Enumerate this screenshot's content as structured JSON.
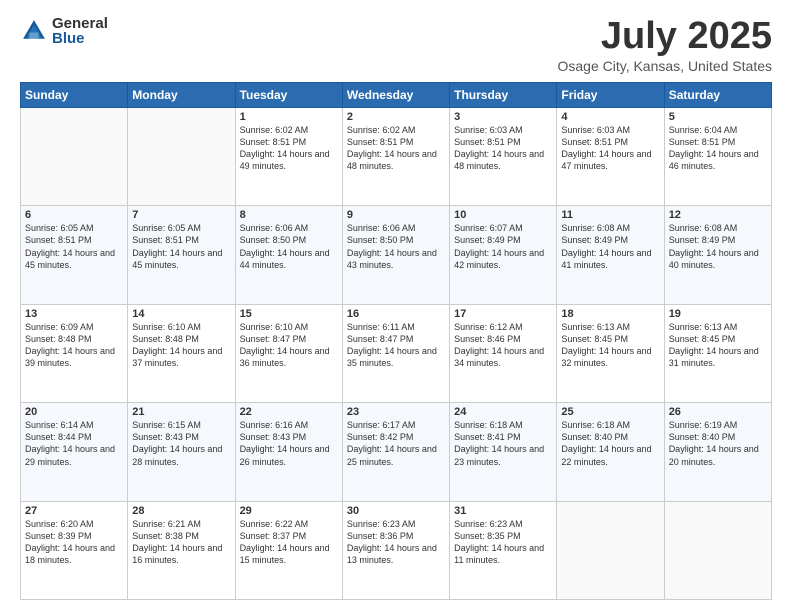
{
  "logo": {
    "general": "General",
    "blue": "Blue"
  },
  "title": "July 2025",
  "subtitle": "Osage City, Kansas, United States",
  "days": [
    "Sunday",
    "Monday",
    "Tuesday",
    "Wednesday",
    "Thursday",
    "Friday",
    "Saturday"
  ],
  "weeks": [
    [
      {
        "day": "",
        "sunrise": "",
        "sunset": "",
        "daylight": ""
      },
      {
        "day": "",
        "sunrise": "",
        "sunset": "",
        "daylight": ""
      },
      {
        "day": "1",
        "sunrise": "Sunrise: 6:02 AM",
        "sunset": "Sunset: 8:51 PM",
        "daylight": "Daylight: 14 hours and 49 minutes."
      },
      {
        "day": "2",
        "sunrise": "Sunrise: 6:02 AM",
        "sunset": "Sunset: 8:51 PM",
        "daylight": "Daylight: 14 hours and 48 minutes."
      },
      {
        "day": "3",
        "sunrise": "Sunrise: 6:03 AM",
        "sunset": "Sunset: 8:51 PM",
        "daylight": "Daylight: 14 hours and 48 minutes."
      },
      {
        "day": "4",
        "sunrise": "Sunrise: 6:03 AM",
        "sunset": "Sunset: 8:51 PM",
        "daylight": "Daylight: 14 hours and 47 minutes."
      },
      {
        "day": "5",
        "sunrise": "Sunrise: 6:04 AM",
        "sunset": "Sunset: 8:51 PM",
        "daylight": "Daylight: 14 hours and 46 minutes."
      }
    ],
    [
      {
        "day": "6",
        "sunrise": "Sunrise: 6:05 AM",
        "sunset": "Sunset: 8:51 PM",
        "daylight": "Daylight: 14 hours and 45 minutes."
      },
      {
        "day": "7",
        "sunrise": "Sunrise: 6:05 AM",
        "sunset": "Sunset: 8:51 PM",
        "daylight": "Daylight: 14 hours and 45 minutes."
      },
      {
        "day": "8",
        "sunrise": "Sunrise: 6:06 AM",
        "sunset": "Sunset: 8:50 PM",
        "daylight": "Daylight: 14 hours and 44 minutes."
      },
      {
        "day": "9",
        "sunrise": "Sunrise: 6:06 AM",
        "sunset": "Sunset: 8:50 PM",
        "daylight": "Daylight: 14 hours and 43 minutes."
      },
      {
        "day": "10",
        "sunrise": "Sunrise: 6:07 AM",
        "sunset": "Sunset: 8:49 PM",
        "daylight": "Daylight: 14 hours and 42 minutes."
      },
      {
        "day": "11",
        "sunrise": "Sunrise: 6:08 AM",
        "sunset": "Sunset: 8:49 PM",
        "daylight": "Daylight: 14 hours and 41 minutes."
      },
      {
        "day": "12",
        "sunrise": "Sunrise: 6:08 AM",
        "sunset": "Sunset: 8:49 PM",
        "daylight": "Daylight: 14 hours and 40 minutes."
      }
    ],
    [
      {
        "day": "13",
        "sunrise": "Sunrise: 6:09 AM",
        "sunset": "Sunset: 8:48 PM",
        "daylight": "Daylight: 14 hours and 39 minutes."
      },
      {
        "day": "14",
        "sunrise": "Sunrise: 6:10 AM",
        "sunset": "Sunset: 8:48 PM",
        "daylight": "Daylight: 14 hours and 37 minutes."
      },
      {
        "day": "15",
        "sunrise": "Sunrise: 6:10 AM",
        "sunset": "Sunset: 8:47 PM",
        "daylight": "Daylight: 14 hours and 36 minutes."
      },
      {
        "day": "16",
        "sunrise": "Sunrise: 6:11 AM",
        "sunset": "Sunset: 8:47 PM",
        "daylight": "Daylight: 14 hours and 35 minutes."
      },
      {
        "day": "17",
        "sunrise": "Sunrise: 6:12 AM",
        "sunset": "Sunset: 8:46 PM",
        "daylight": "Daylight: 14 hours and 34 minutes."
      },
      {
        "day": "18",
        "sunrise": "Sunrise: 6:13 AM",
        "sunset": "Sunset: 8:45 PM",
        "daylight": "Daylight: 14 hours and 32 minutes."
      },
      {
        "day": "19",
        "sunrise": "Sunrise: 6:13 AM",
        "sunset": "Sunset: 8:45 PM",
        "daylight": "Daylight: 14 hours and 31 minutes."
      }
    ],
    [
      {
        "day": "20",
        "sunrise": "Sunrise: 6:14 AM",
        "sunset": "Sunset: 8:44 PM",
        "daylight": "Daylight: 14 hours and 29 minutes."
      },
      {
        "day": "21",
        "sunrise": "Sunrise: 6:15 AM",
        "sunset": "Sunset: 8:43 PM",
        "daylight": "Daylight: 14 hours and 28 minutes."
      },
      {
        "day": "22",
        "sunrise": "Sunrise: 6:16 AM",
        "sunset": "Sunset: 8:43 PM",
        "daylight": "Daylight: 14 hours and 26 minutes."
      },
      {
        "day": "23",
        "sunrise": "Sunrise: 6:17 AM",
        "sunset": "Sunset: 8:42 PM",
        "daylight": "Daylight: 14 hours and 25 minutes."
      },
      {
        "day": "24",
        "sunrise": "Sunrise: 6:18 AM",
        "sunset": "Sunset: 8:41 PM",
        "daylight": "Daylight: 14 hours and 23 minutes."
      },
      {
        "day": "25",
        "sunrise": "Sunrise: 6:18 AM",
        "sunset": "Sunset: 8:40 PM",
        "daylight": "Daylight: 14 hours and 22 minutes."
      },
      {
        "day": "26",
        "sunrise": "Sunrise: 6:19 AM",
        "sunset": "Sunset: 8:40 PM",
        "daylight": "Daylight: 14 hours and 20 minutes."
      }
    ],
    [
      {
        "day": "27",
        "sunrise": "Sunrise: 6:20 AM",
        "sunset": "Sunset: 8:39 PM",
        "daylight": "Daylight: 14 hours and 18 minutes."
      },
      {
        "day": "28",
        "sunrise": "Sunrise: 6:21 AM",
        "sunset": "Sunset: 8:38 PM",
        "daylight": "Daylight: 14 hours and 16 minutes."
      },
      {
        "day": "29",
        "sunrise": "Sunrise: 6:22 AM",
        "sunset": "Sunset: 8:37 PM",
        "daylight": "Daylight: 14 hours and 15 minutes."
      },
      {
        "day": "30",
        "sunrise": "Sunrise: 6:23 AM",
        "sunset": "Sunset: 8:36 PM",
        "daylight": "Daylight: 14 hours and 13 minutes."
      },
      {
        "day": "31",
        "sunrise": "Sunrise: 6:23 AM",
        "sunset": "Sunset: 8:35 PM",
        "daylight": "Daylight: 14 hours and 11 minutes."
      },
      {
        "day": "",
        "sunrise": "",
        "sunset": "",
        "daylight": ""
      },
      {
        "day": "",
        "sunrise": "",
        "sunset": "",
        "daylight": ""
      }
    ]
  ]
}
